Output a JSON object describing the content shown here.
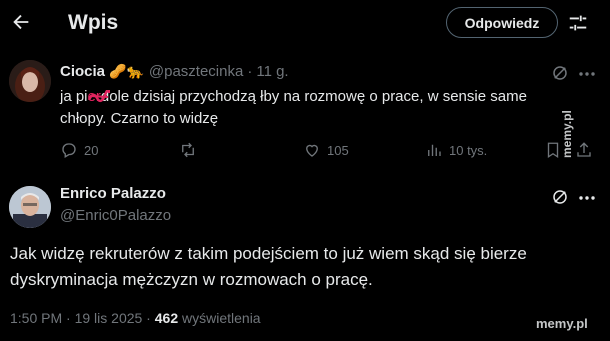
{
  "header": {
    "title": "Wpis",
    "reply_label": "Odpowiedz"
  },
  "parent_post": {
    "author_name": "Ciocia",
    "author_emojis": "🥜🐆",
    "handle": "@pasztecinka",
    "separator": "·",
    "time": "11 g.",
    "text_line1_pre": "ja pi",
    "text_line1_scribbled": "er",
    "text_line1_post": "dole dzisiaj przychodzą łby na rozmowę o prace, w sensie same",
    "text_line2": "chłopy. Czarno to widzę",
    "replies": "20",
    "likes": "105",
    "views": "10 tys."
  },
  "main_post": {
    "author_name": "Enrico Palazzo",
    "handle": "@Enric0Palazzo",
    "text_line1": "Jak widzę rekruterów z takim podejściem to już wiem skąd się bierze",
    "text_line2": "dyskryminacja mężczyzn w rozmowach o pracę.",
    "timestamp": "1:50 PM · 19 lis 2025 ·",
    "views_count": "462",
    "views_label": "wyświetlenia"
  },
  "watermarks": {
    "side": "memy.pl",
    "bottom": "memy.pl"
  },
  "colors": {
    "background": "#000000",
    "text": "#e7e9ea",
    "muted": "#71767b",
    "divider": "#2f3336",
    "scribble": "#e0245e"
  }
}
